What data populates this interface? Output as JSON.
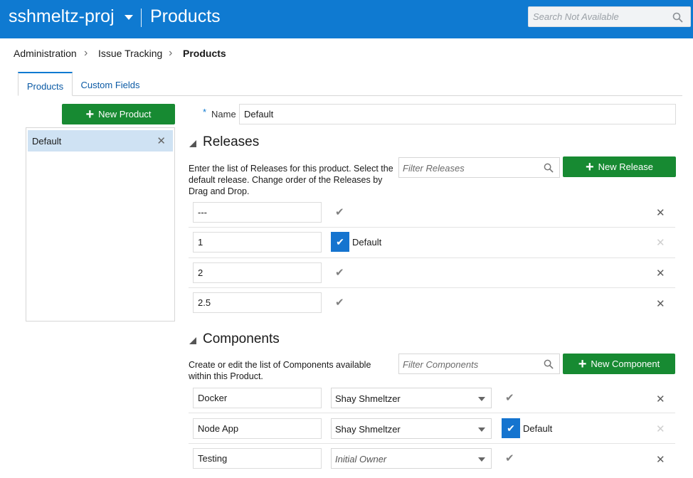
{
  "header": {
    "project": "sshmeltz-proj",
    "title": "Products",
    "search_placeholder": "Search Not Available"
  },
  "breadcrumb": [
    "Administration",
    "Issue Tracking",
    "Products"
  ],
  "tabs": [
    {
      "label": "Products",
      "active": true
    },
    {
      "label": "Custom Fields",
      "active": false
    }
  ],
  "sidebar": {
    "new_product": "New Product",
    "products": [
      {
        "label": "Default",
        "selected": true
      }
    ]
  },
  "form": {
    "required_mark": "*",
    "name_label": "Name",
    "name_value": "Default"
  },
  "releases": {
    "title": "Releases",
    "description": "Enter the list of Releases for this product. Select the default release. Change order of the Releases by Drag and Drop.",
    "filter_placeholder": "Filter Releases",
    "new_button": "New Release",
    "default_label": "Default",
    "items": [
      {
        "value": "---",
        "is_default": false
      },
      {
        "value": "1",
        "is_default": true
      },
      {
        "value": "2",
        "is_default": false
      },
      {
        "value": "2.5",
        "is_default": false
      }
    ]
  },
  "components": {
    "title": "Components",
    "description": "Create or edit the list of Components available within this Product.",
    "filter_placeholder": "Filter Components",
    "new_button": "New Component",
    "default_label": "Default",
    "items": [
      {
        "name": "Docker",
        "owner": "Shay Shmeltzer",
        "is_default": false
      },
      {
        "name": "Node App",
        "owner": "Shay Shmeltzer",
        "is_default": true
      },
      {
        "name": "Testing",
        "owner": "Initial Owner",
        "is_default": false
      }
    ]
  },
  "icons": {
    "check": "✔",
    "close": "✕",
    "plus": "+"
  },
  "colors": {
    "header": "#0f7ad1",
    "primary_button": "#178a32",
    "selected_item": "#cfe2f3",
    "default_checkbox": "#1574cf"
  }
}
